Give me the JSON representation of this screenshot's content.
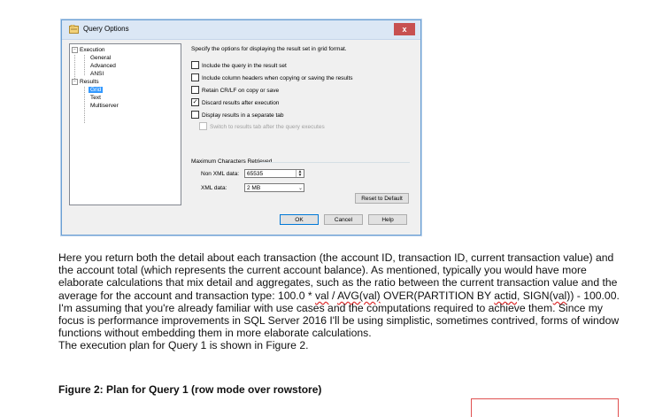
{
  "dialog": {
    "title": "Query Options",
    "close_label": "x",
    "tree": {
      "execution": "Execution",
      "general": "General",
      "advanced": "Advanced",
      "ansi": "ANSI",
      "results": "Results",
      "grid": "Grid",
      "text": "Text",
      "multiserver": "Multiserver"
    },
    "intro": "Specify the options for displaying the result set in grid format.",
    "options": [
      {
        "label": "Include the query in the result set",
        "checked": false
      },
      {
        "label": "Include column headers when copying or saving the results",
        "checked": false
      },
      {
        "label": "Retain CR/LF on copy or save",
        "checked": false
      },
      {
        "label": "Discard results after execution",
        "checked": true
      },
      {
        "label": "Display results in a separate tab",
        "checked": false
      },
      {
        "label": "Switch to results tab after the query executes",
        "checked": false,
        "disabled": true
      }
    ],
    "max_chars_label": "Maximum Characters Retrieved",
    "non_xml_label": "Non XML data:",
    "non_xml_value": "65535",
    "xml_label": "XML data:",
    "xml_value": "2 MB",
    "reset_label": "Reset to Default",
    "ok_label": "OK",
    "cancel_label": "Cancel",
    "help_label": "Help"
  },
  "text": {
    "p1_a": "Here you return both the detail about each transaction (the account ID, transaction ID, current transaction value) and the account total (which represents the current account balance). As mentioned, typically you would have more elaborate calculations that mix detail and aggregates, such as the ratio between the current transaction value and the average for the account and transaction type: 100.0 * ",
    "val1": "val",
    "p1_b": " / ",
    "avg": "AVG(val)",
    "p1_c": " OVER(PARTITION BY ",
    "actid": "actid",
    "p1_d": ", SIGN(",
    "val2": "val",
    "p1_e": ")) - 100.00. I'm assuming that you're already familiar with use cases and the computations required to achieve them. Since my focus is performance improvements in SQL Server 2016 I'll be using simplistic, sometimes contrived, forms of window functions without embedding them in more elaborate calculations.",
    "p2": "The execution plan for Query 1 is shown in Figure 2.",
    "caption": "Figure 2: Plan for Query 1 (row mode over rowstore)"
  }
}
